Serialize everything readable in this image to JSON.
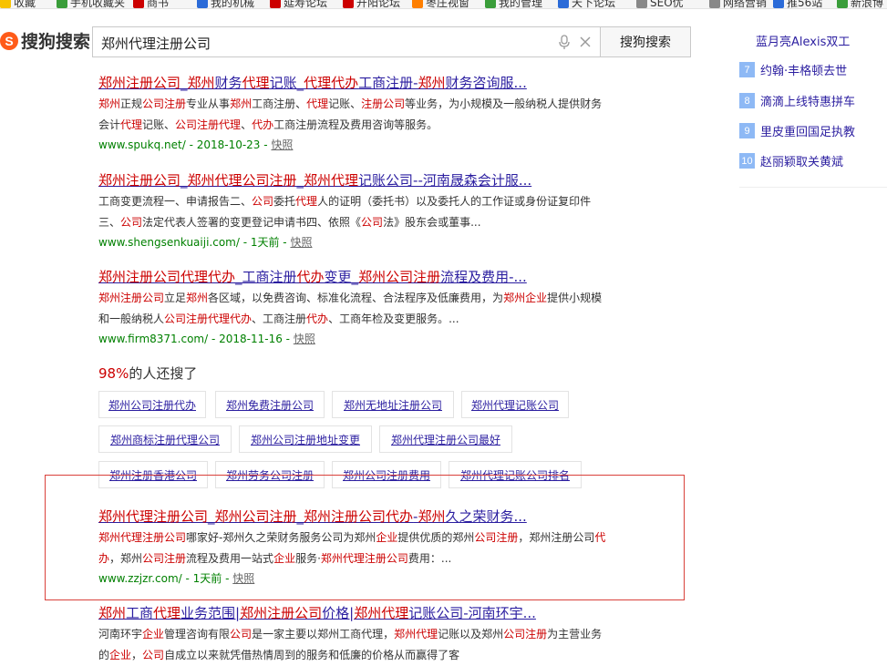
{
  "bookmarks": [
    {
      "label": "收藏",
      "color": "#f7c200"
    },
    {
      "label": "手机收藏夹",
      "color": "#3a9d3a"
    },
    {
      "label": "商书",
      "color": "#c00"
    },
    {
      "label": "我的机械",
      "color": "#2b6bd8"
    },
    {
      "label": "延寿论坛",
      "color": "#c00"
    },
    {
      "label": "开阳论坛",
      "color": "#c00"
    },
    {
      "label": "枣庄视窗",
      "color": "#ff7f00"
    },
    {
      "label": "我的管理",
      "color": "#3a9d3a"
    },
    {
      "label": "天下论坛",
      "color": "#2b6bd8"
    },
    {
      "label": "SEO优",
      "color": "#888"
    },
    {
      "label": "网络营销",
      "color": "#888"
    },
    {
      "label": "推56站",
      "color": "#2b6bd8"
    },
    {
      "label": "新浪博",
      "color": "#3a9d3a"
    }
  ],
  "header": {
    "logo_mark": "S",
    "logo_text": "搜狗搜索",
    "query": "郑州代理注册公司",
    "search_button": "搜狗搜索"
  },
  "results": [
    {
      "title": [
        {
          "t": "郑州注册公司",
          "h": true
        },
        {
          "t": "_",
          "h": false
        },
        {
          "t": "郑州",
          "h": true
        },
        {
          "t": "财务",
          "h": false
        },
        {
          "t": "代理",
          "h": true
        },
        {
          "t": "记账_",
          "h": false
        },
        {
          "t": "代理代办",
          "h": true
        },
        {
          "t": "工商注册-",
          "h": false
        },
        {
          "t": "郑州",
          "h": true
        },
        {
          "t": "财务咨询服...",
          "h": false
        }
      ],
      "desc": [
        {
          "t": "郑州",
          "h": true
        },
        {
          "t": "正规",
          "h": false
        },
        {
          "t": "公司注册",
          "h": true
        },
        {
          "t": "专业从事",
          "h": false
        },
        {
          "t": "郑州",
          "h": true
        },
        {
          "t": "工商注册、",
          "h": false
        },
        {
          "t": "代理",
          "h": true
        },
        {
          "t": "记账、",
          "h": false
        },
        {
          "t": "注册公司",
          "h": true
        },
        {
          "t": "等业务，为小规模及一般纳税人提供财务会计",
          "h": false
        },
        {
          "t": "代理",
          "h": true
        },
        {
          "t": "记账、",
          "h": false
        },
        {
          "t": "公司注册代理",
          "h": true
        },
        {
          "t": "、",
          "h": false
        },
        {
          "t": "代办",
          "h": true
        },
        {
          "t": "工商注册流程及费用咨询等服务。",
          "h": false
        }
      ],
      "url": "www.spukq.net/ - 2018-10-23 - ",
      "snapshot": "快照"
    },
    {
      "title": [
        {
          "t": "郑州注册公司",
          "h": true
        },
        {
          "t": "_",
          "h": false
        },
        {
          "t": "郑州代理公司注册",
          "h": true
        },
        {
          "t": "_",
          "h": false
        },
        {
          "t": "郑州代理",
          "h": true
        },
        {
          "t": "记账公司--河南晟森会计服...",
          "h": false
        }
      ],
      "desc": [
        {
          "t": "工商变更流程一、申请报告二、",
          "h": false
        },
        {
          "t": "公司",
          "h": true
        },
        {
          "t": "委托",
          "h": false
        },
        {
          "t": "代理",
          "h": true
        },
        {
          "t": "人的证明（委托书）以及委托人的工作证或身份证复印件三、",
          "h": false
        },
        {
          "t": "公司",
          "h": true
        },
        {
          "t": "法定代表人签署的变更登记申请书四、依照《",
          "h": false
        },
        {
          "t": "公司",
          "h": true
        },
        {
          "t": "法》股东会或董事...",
          "h": false
        }
      ],
      "url": "www.shengsenkuaiji.com/ - 1天前 - ",
      "snapshot": "快照"
    },
    {
      "title": [
        {
          "t": "郑州注册公司代理代办",
          "h": true
        },
        {
          "t": "_工商注册",
          "h": false
        },
        {
          "t": "代办",
          "h": true
        },
        {
          "t": "变更_",
          "h": false
        },
        {
          "t": "郑州公司注册",
          "h": true
        },
        {
          "t": "流程及费用-...",
          "h": false
        }
      ],
      "desc": [
        {
          "t": "郑州注册公司",
          "h": true
        },
        {
          "t": "立足",
          "h": false
        },
        {
          "t": "郑州",
          "h": true
        },
        {
          "t": "各区域，以免费咨询、标准化流程、合法程序及低廉费用，为",
          "h": false
        },
        {
          "t": "郑州企业",
          "h": true
        },
        {
          "t": "提供小规模和一般纳税人",
          "h": false
        },
        {
          "t": "公司注册代理代办",
          "h": true
        },
        {
          "t": "、工商注册",
          "h": false
        },
        {
          "t": "代办",
          "h": true
        },
        {
          "t": "、工商年检及变更服务。...",
          "h": false
        }
      ],
      "url": "www.firm8371.com/ - 2018-11-16 - ",
      "snapshot": "快照"
    },
    {
      "title": [
        {
          "t": "郑州代理注册公司",
          "h": true
        },
        {
          "t": "_",
          "h": false
        },
        {
          "t": "郑州公司注册",
          "h": true
        },
        {
          "t": "_",
          "h": false
        },
        {
          "t": "郑州注册公司代办",
          "h": true
        },
        {
          "t": "-",
          "h": false
        },
        {
          "t": "郑州",
          "h": true
        },
        {
          "t": "久之荣财务...",
          "h": false
        }
      ],
      "desc": [
        {
          "t": "郑州代理注册公司",
          "h": true
        },
        {
          "t": "哪家好-郑州久之荣财务服务公司为郑州",
          "h": false
        },
        {
          "t": "企业",
          "h": true
        },
        {
          "t": "提供优质的郑州",
          "h": false
        },
        {
          "t": "公司注册",
          "h": true
        },
        {
          "t": "，郑州注册公司",
          "h": false
        },
        {
          "t": "代办",
          "h": true
        },
        {
          "t": "，郑州",
          "h": false
        },
        {
          "t": "公司注册",
          "h": true
        },
        {
          "t": "流程及费用一站式",
          "h": false
        },
        {
          "t": "企业",
          "h": true
        },
        {
          "t": "服务·",
          "h": false
        },
        {
          "t": "郑州代理注册公司",
          "h": true
        },
        {
          "t": "费用：...",
          "h": false
        }
      ],
      "url": "www.zzjzr.com/ - 1天前 - ",
      "snapshot": "快照"
    },
    {
      "title": [
        {
          "t": "郑州",
          "h": true
        },
        {
          "t": "工商",
          "h": false
        },
        {
          "t": "代理",
          "h": true
        },
        {
          "t": "业务范围|",
          "h": false
        },
        {
          "t": "郑州注册公司",
          "h": true
        },
        {
          "t": "价格|",
          "h": false
        },
        {
          "t": "郑州代理",
          "h": true
        },
        {
          "t": "记账公司-河南环宇...",
          "h": false
        }
      ],
      "desc": [
        {
          "t": "河南环宇",
          "h": false
        },
        {
          "t": "企业",
          "h": true
        },
        {
          "t": "管理咨询有限",
          "h": false
        },
        {
          "t": "公司",
          "h": true
        },
        {
          "t": "是一家主要以郑州工商代理，",
          "h": false
        },
        {
          "t": "郑州代理",
          "h": true
        },
        {
          "t": "记账以及郑州",
          "h": false
        },
        {
          "t": "公司注册",
          "h": true
        },
        {
          "t": "为主营业务的",
          "h": false
        },
        {
          "t": "企业",
          "h": true
        },
        {
          "t": "，",
          "h": false
        },
        {
          "t": "公司",
          "h": true
        },
        {
          "t": "自成立以来就凭借热情周到的服务和低廉的价格从而赢得了客",
          "h": false
        }
      ],
      "url": "",
      "snapshot": ""
    }
  ],
  "also_searched": {
    "percent": "98%",
    "text": "的人还搜了",
    "tags": [
      "郑州公司注册代办",
      "郑州免费注册公司",
      "郑州无地址注册公司",
      "郑州代理记账公司",
      "郑州商标注册代理公司",
      "郑州公司注册地址变更",
      "郑州代理注册公司最好",
      "郑州注册香港公司",
      "郑州劳务公司注册",
      "郑州公司注册费用",
      "郑州代理记账公司排名"
    ]
  },
  "sidebar": {
    "top_partial_1": "蓝月亮Alexis双工",
    "top_partial_2": "约翰·丰格顿去世",
    "ranks": [
      {
        "num": "8",
        "text": "滴滴上线特惠拼车"
      },
      {
        "num": "9",
        "text": "里皮重回国足执教"
      },
      {
        "num": "10",
        "text": "赵丽颖取关黄斌"
      }
    ]
  }
}
